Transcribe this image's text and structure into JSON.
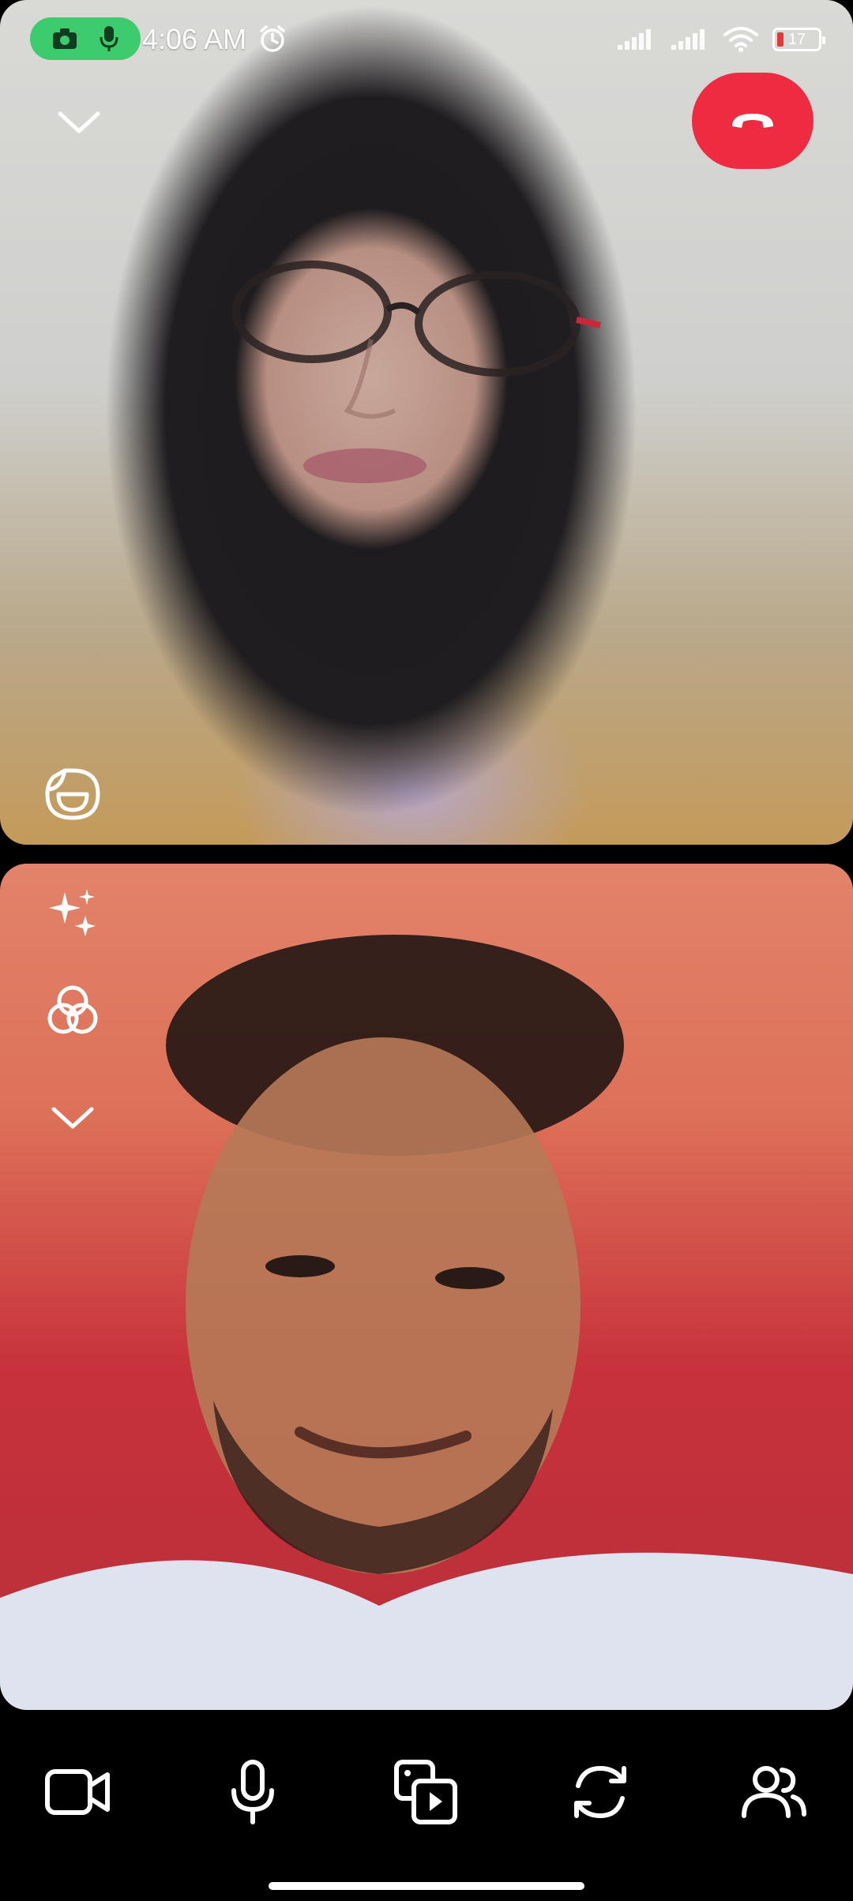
{
  "status_bar": {
    "time": "4:06 AM",
    "battery_level": "17",
    "icons": [
      "camera-icon",
      "mic-icon",
      "alarm-icon",
      "signal-icon",
      "signal-icon",
      "wifi-icon",
      "battery-icon"
    ],
    "recording_pill_color": "#3ccb6d"
  },
  "call": {
    "end_call_color": "#ef2b41",
    "remote_tile": {
      "icons": [
        "chevron-down-icon",
        "phone-hangup-icon",
        "sticker-icon"
      ]
    },
    "local_tile": {
      "icons": [
        "sparkles-icon",
        "filter-icon",
        "chevron-down-icon"
      ]
    }
  },
  "controls": [
    {
      "name": "camera-toggle",
      "icon": "video-camera-icon"
    },
    {
      "name": "mic-toggle",
      "icon": "microphone-icon"
    },
    {
      "name": "media-share",
      "icon": "media-play-icon"
    },
    {
      "name": "switch-camera",
      "icon": "camera-switch-icon"
    },
    {
      "name": "participants",
      "icon": "people-icon"
    }
  ]
}
